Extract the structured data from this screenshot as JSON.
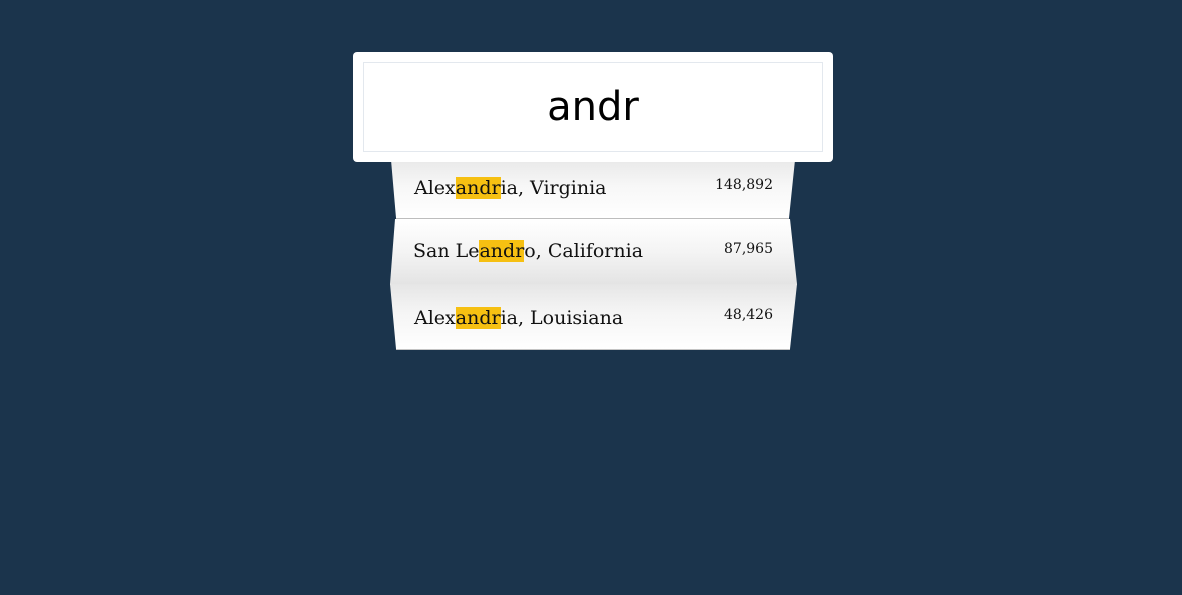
{
  "search": {
    "value": "andr",
    "highlight_color": "#f6c012",
    "background_color": "#1b344c"
  },
  "results": [
    {
      "name_before": "Alex",
      "name_match": "andr",
      "name_after": "ia, Virginia",
      "population": "148,892"
    },
    {
      "name_before": "San Le",
      "name_match": "andr",
      "name_after": "o, California",
      "population": "87,965"
    },
    {
      "name_before": "Alex",
      "name_match": "andr",
      "name_after": "ia, Louisiana",
      "population": "48,426"
    }
  ]
}
